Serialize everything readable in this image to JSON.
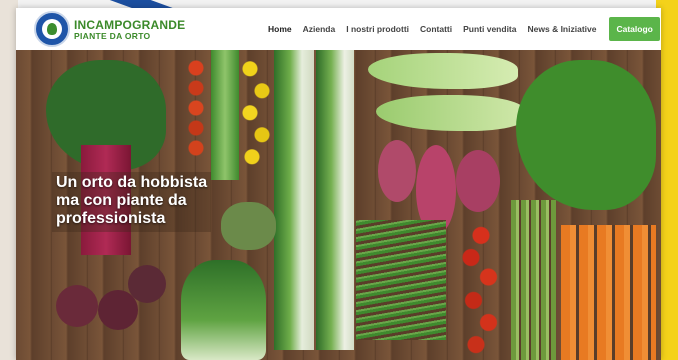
{
  "header": {
    "logo_title": "INCAMPOGRANDE",
    "logo_subtitle": "PIANTE DA ORTO",
    "nav": [
      {
        "label": "Home",
        "active": true
      },
      {
        "label": "Azienda",
        "active": false
      },
      {
        "label": "I nostri prodotti",
        "active": false
      },
      {
        "label": "Contatti",
        "active": false
      },
      {
        "label": "Punti vendita",
        "active": false
      },
      {
        "label": "News & Iniziative",
        "active": false
      }
    ],
    "catalog_label": "Catalogo",
    "search_icon": "search-icon"
  },
  "hero": {
    "lines": [
      "Un orto da hobbista",
      "ma con piante da",
      "professionista"
    ]
  },
  "colors": {
    "brand_green": "#3b8a2a",
    "button_green": "#5bb54a",
    "badge_blue": "#1f55a8",
    "accent_yellow": "#f4d21a"
  }
}
